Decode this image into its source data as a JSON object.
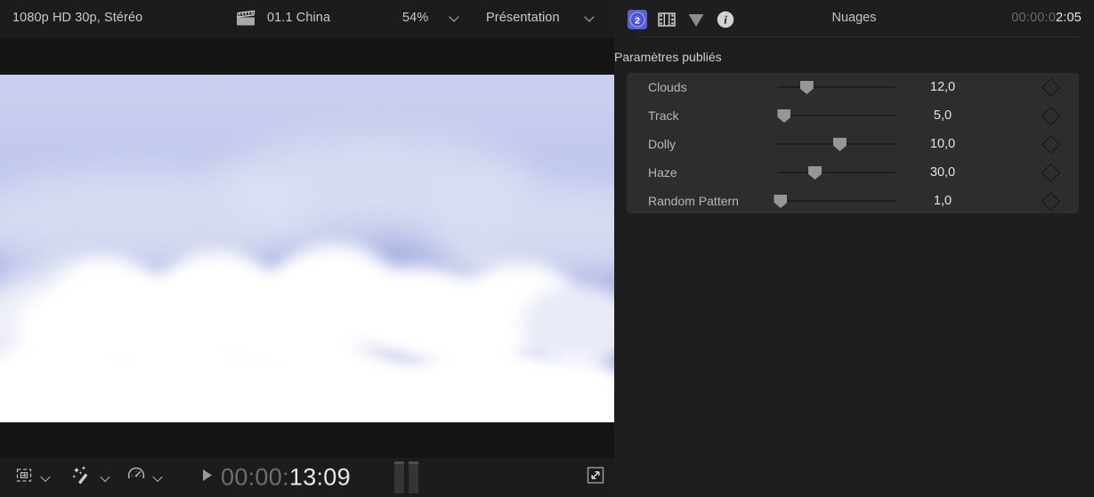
{
  "viewer": {
    "topbar": {
      "format": "1080p HD 30p, Stéréo",
      "clip_icon": "clapperboard-icon",
      "clip_name": "01.1 China",
      "zoom_level": "54%",
      "zoom_chevron": "chevron-down-icon",
      "view_mode": "Présentation",
      "view_chevron": "chevron-down-icon"
    },
    "bottombar": {
      "crop_icon": "crop-transform-icon",
      "crop_chevron": "chevron-down-icon",
      "effects_icon": "magic-wand-icon",
      "effects_chevron": "chevron-down-icon",
      "retime_icon": "speed-gauge-icon",
      "retime_chevron": "chevron-down-icon",
      "play_icon": "play-triangle-icon",
      "timecode_dim": "00:00:",
      "timecode_bright": "13:09",
      "pause_icon": "pause-bars-icon",
      "expand_icon": "expand-arrows-icon"
    }
  },
  "inspector": {
    "icons": [
      "published-parameters-icon",
      "video-filmstrip-icon",
      "color-triangle-icon",
      "info-icon"
    ],
    "title": "Nuages",
    "timecode_dim": "00:00:0",
    "timecode_bright": "2:05",
    "published_header": "Paramètres publiés",
    "params": [
      {
        "label": "Clouds",
        "value": "12,0",
        "slider_pct": 25,
        "keyframe_icon": "keyframe-diamond-icon"
      },
      {
        "label": "Track",
        "value": "5,0",
        "slider_pct": 6,
        "keyframe_icon": "keyframe-diamond-icon"
      },
      {
        "label": "Dolly",
        "value": "10,0",
        "slider_pct": 53,
        "keyframe_icon": "keyframe-diamond-icon"
      },
      {
        "label": "Haze",
        "value": "30,0",
        "slider_pct": 32,
        "keyframe_icon": "keyframe-diamond-icon"
      },
      {
        "label": "Random Pattern",
        "value": "1,0",
        "slider_pct": 3,
        "keyframe_icon": "keyframe-diamond-icon"
      }
    ]
  },
  "colors": {
    "accent_blue": "#5b5fd8",
    "panel_bg": "#1e1e1e",
    "group_bg": "#2d2d2d",
    "bar_bg": "#1c1c1c",
    "sky_top": "#ccd0ef",
    "sky_bottom": "#6370bf"
  }
}
